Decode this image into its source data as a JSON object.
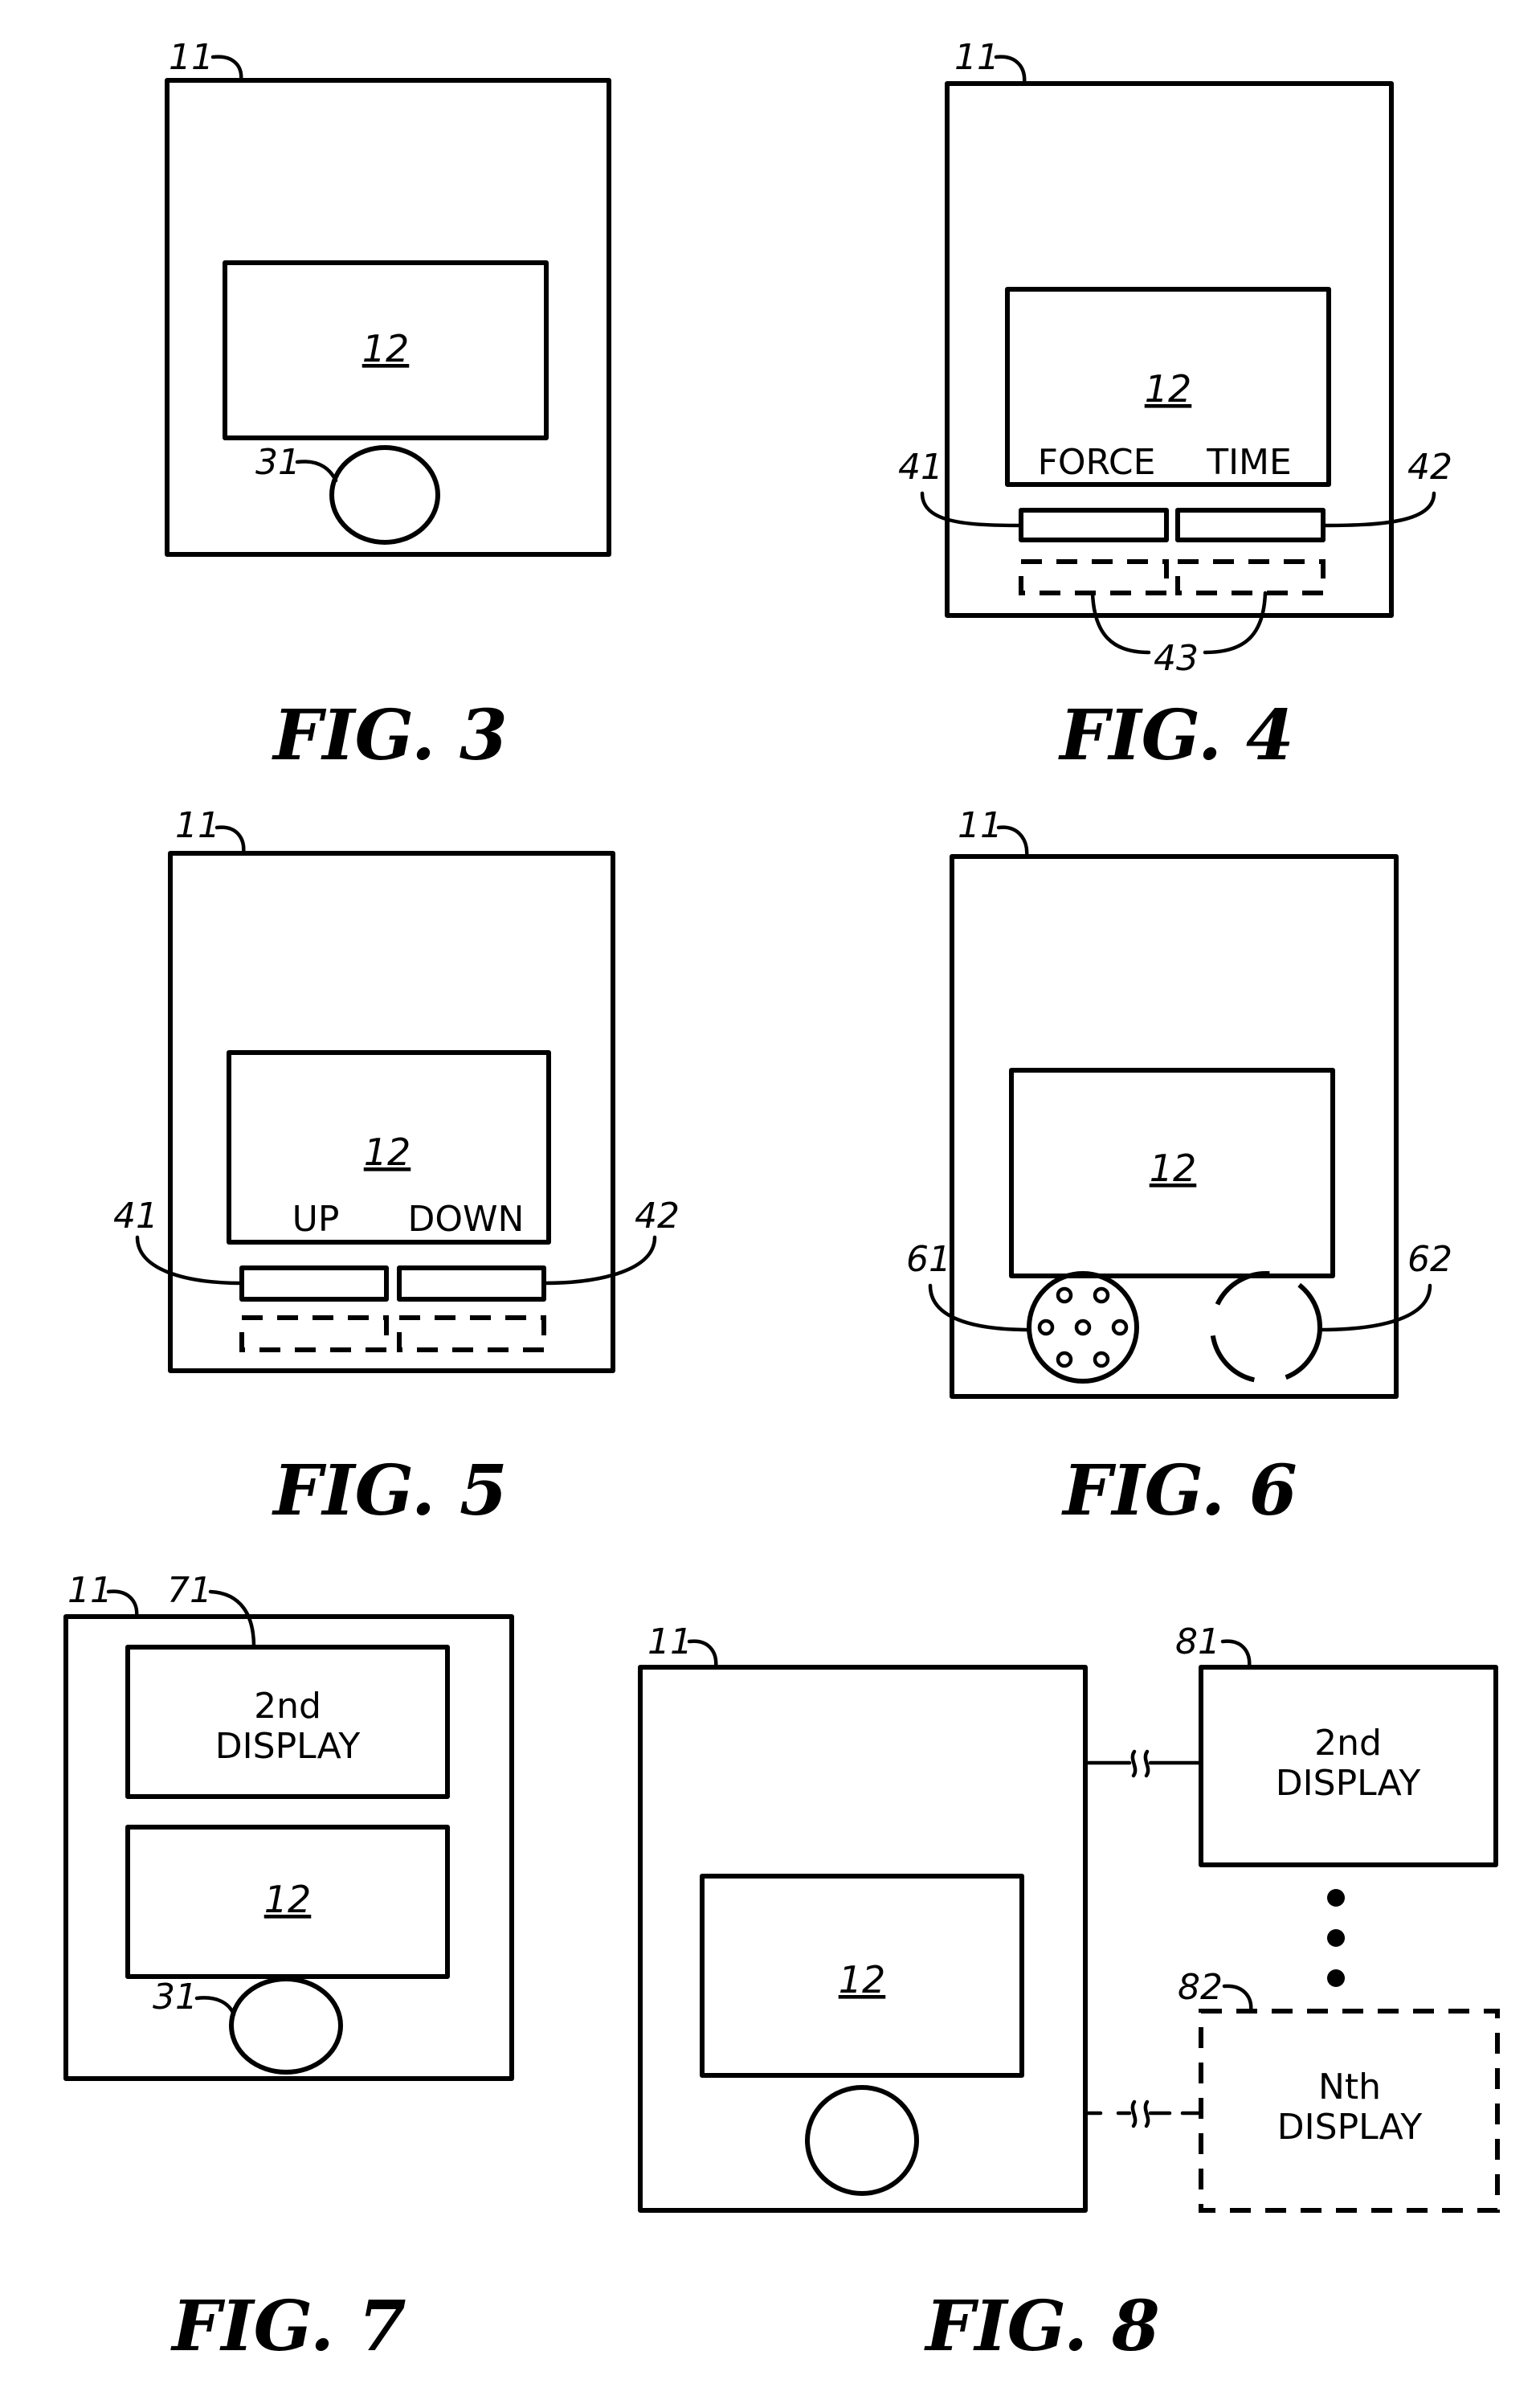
{
  "figures": [
    {
      "id": "fig3",
      "caption": "FIG. 3",
      "refs": {
        "device": "11",
        "button": "31"
      },
      "display_label": "12"
    },
    {
      "id": "fig4",
      "caption": "FIG. 4",
      "refs": {
        "device": "11",
        "left_button": "41",
        "right_button": "42",
        "optional_buttons": "43"
      },
      "display_label": "12",
      "softkey_labels": [
        "FORCE",
        "TIME"
      ]
    },
    {
      "id": "fig5",
      "caption": "FIG. 5",
      "refs": {
        "device": "11",
        "left_button": "41",
        "right_button": "42"
      },
      "display_label": "12",
      "softkey_labels": [
        "UP",
        "DOWN"
      ]
    },
    {
      "id": "fig6",
      "caption": "FIG. 6",
      "refs": {
        "device": "11",
        "speaker": "61",
        "optional_element": "62"
      },
      "display_label": "12"
    },
    {
      "id": "fig7",
      "caption": "FIG. 7",
      "refs": {
        "device": "11",
        "second_display": "71",
        "button": "31"
      },
      "display_label": "12",
      "second_display_text": [
        "2nd",
        "DISPLAY"
      ]
    },
    {
      "id": "fig8",
      "caption": "FIG. 8",
      "refs": {
        "device": "11",
        "second_display": "81",
        "nth_display": "82"
      },
      "display_label": "12",
      "second_display_text": [
        "2nd",
        "DISPLAY"
      ],
      "nth_display_text": [
        "Nth",
        "DISPLAY"
      ]
    }
  ]
}
